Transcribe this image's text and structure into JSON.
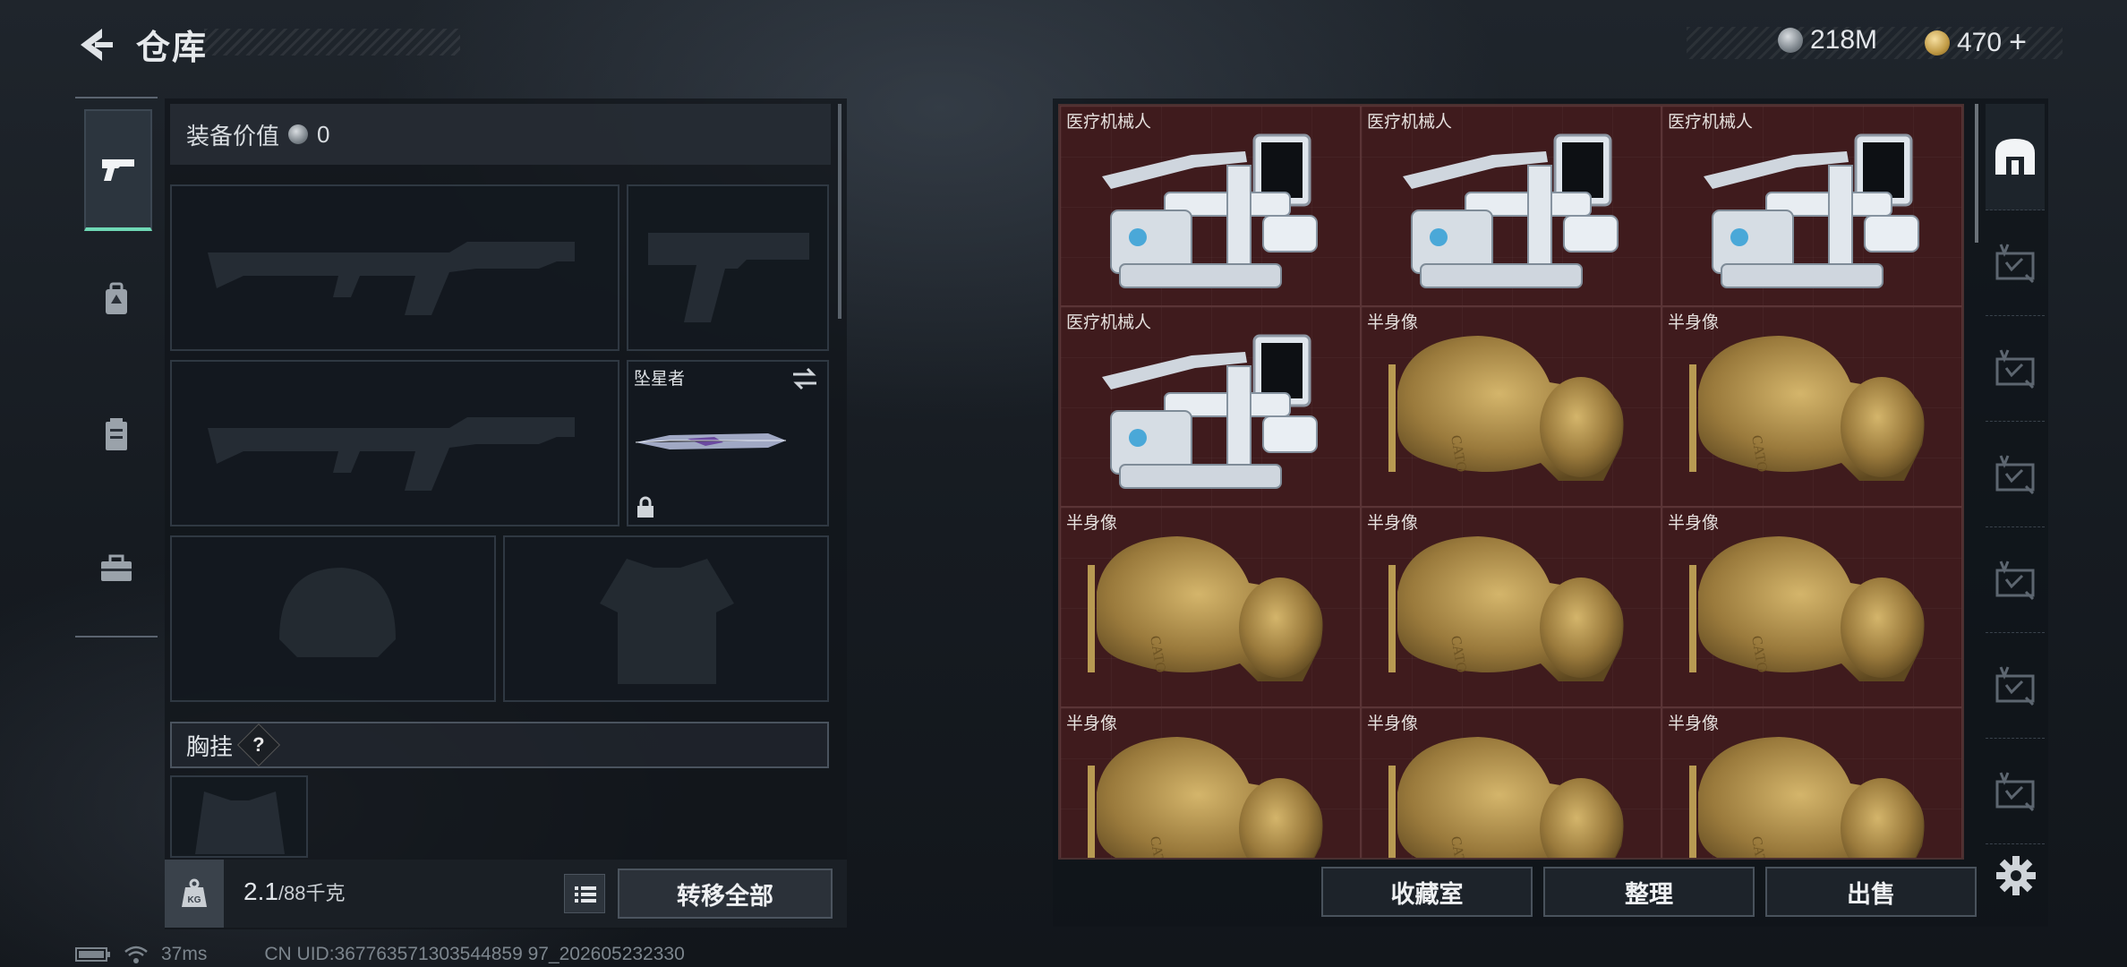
{
  "header": {
    "title": "仓库"
  },
  "currency": {
    "silver": "218M",
    "gold": "470",
    "gold_plus": "+"
  },
  "nav": {
    "items": [
      "weapons",
      "backpack",
      "armor",
      "toolbox"
    ]
  },
  "equipment": {
    "value_label": "装备价值",
    "value": "0",
    "melee_name": "坠星者",
    "chest_rig_label": "胸挂",
    "help": "?"
  },
  "footer_left": {
    "weight_current": "2.1",
    "weight_max": "/88",
    "weight_unit": "千克",
    "icon_text": "KG",
    "transfer_all": "转移全部"
  },
  "grid_items": [
    {
      "label": "医疗机械人",
      "kind": "robot"
    },
    {
      "label": "医疗机械人",
      "kind": "robot"
    },
    {
      "label": "医疗机械人",
      "kind": "robot"
    },
    {
      "label": "医疗机械人",
      "kind": "robot"
    },
    {
      "label": "半身像",
      "kind": "bust"
    },
    {
      "label": "半身像",
      "kind": "bust"
    },
    {
      "label": "半身像",
      "kind": "bust"
    },
    {
      "label": "半身像",
      "kind": "bust"
    },
    {
      "label": "半身像",
      "kind": "bust"
    },
    {
      "label": "半身像",
      "kind": "bust"
    },
    {
      "label": "半身像",
      "kind": "bust"
    },
    {
      "label": "半身像",
      "kind": "bust"
    }
  ],
  "bust_engraving": "CATO",
  "side_tabs": [
    "home-tab",
    "storage-tab",
    "storage-tab",
    "storage-tab",
    "storage-tab",
    "storage-tab",
    "storage-tab"
  ],
  "footer_right": {
    "collection": "收藏室",
    "organize": "整理",
    "sell": "出售"
  },
  "status": {
    "ping": "37ms",
    "uid": "CN UID:367763571303544859 97_202605232330"
  }
}
